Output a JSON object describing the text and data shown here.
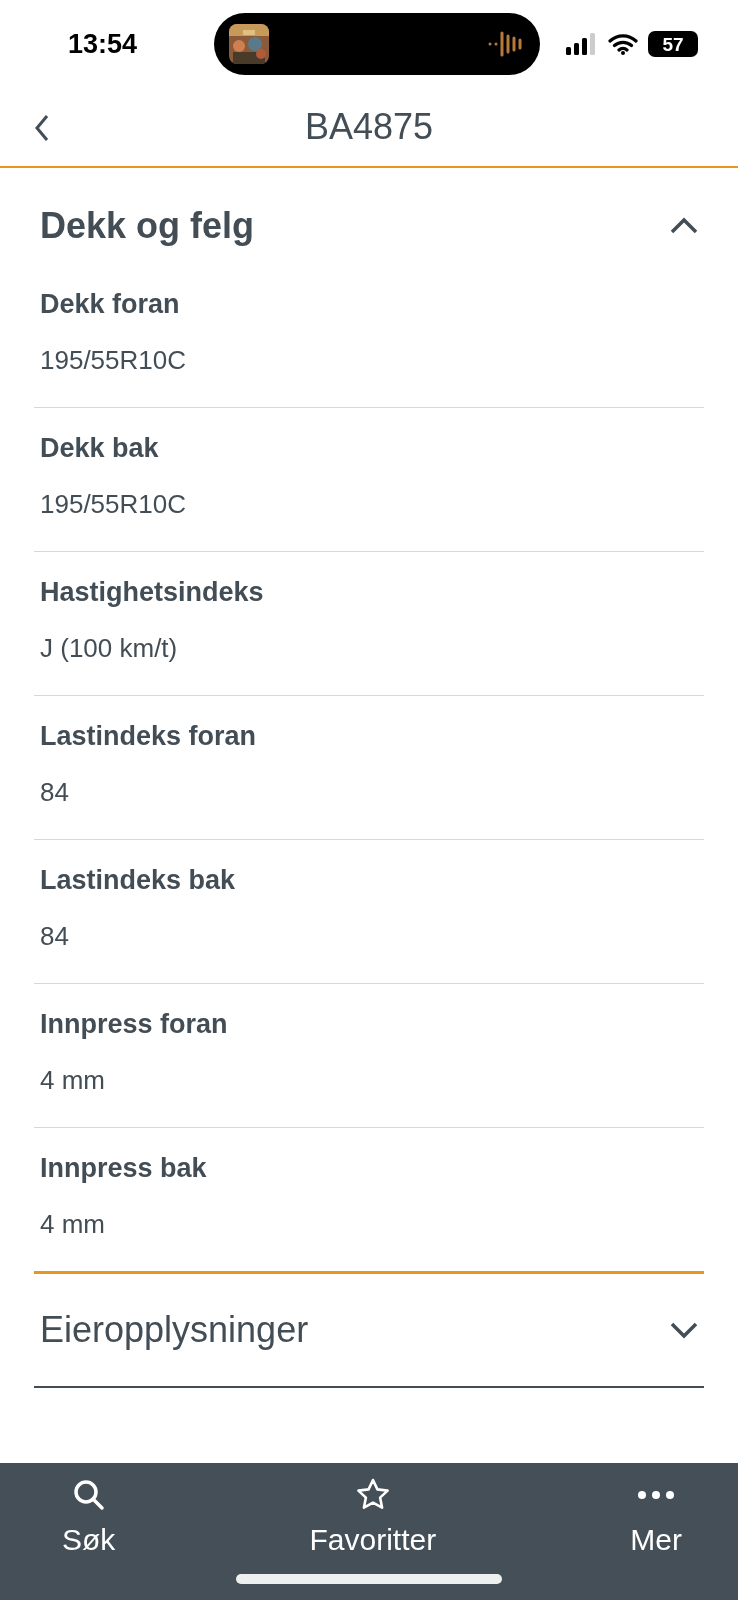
{
  "status_bar": {
    "time": "13:54",
    "battery": "57"
  },
  "header": {
    "title": "BA4875"
  },
  "sections": [
    {
      "title": "Dekk og felg",
      "expanded": true,
      "fields": [
        {
          "label": "Dekk foran",
          "value": "195/55R10C"
        },
        {
          "label": "Dekk bak",
          "value": "195/55R10C"
        },
        {
          "label": "Hastighetsindeks",
          "value": "J (100  km/t)"
        },
        {
          "label": "Lastindeks foran",
          "value": "84"
        },
        {
          "label": "Lastindeks bak",
          "value": "84"
        },
        {
          "label": "Innpress foran",
          "value": "4 mm"
        },
        {
          "label": "Innpress bak",
          "value": "4 mm"
        }
      ]
    },
    {
      "title": "Eieropplysninger",
      "expanded": false
    }
  ],
  "tab_bar": [
    {
      "kind": "search",
      "label": "Søk"
    },
    {
      "kind": "favorites",
      "label": "Favoritter"
    },
    {
      "kind": "more",
      "label": "Mer"
    }
  ]
}
